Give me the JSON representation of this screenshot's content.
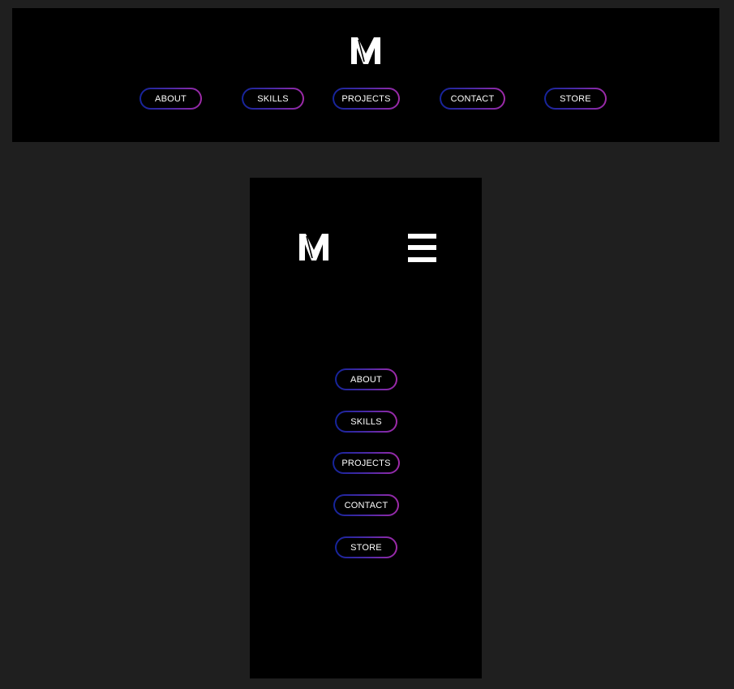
{
  "brand": {
    "logo_letter": "M",
    "logo_color": "#ffffff"
  },
  "theme": {
    "page_background": "#1f1f1f",
    "frame_background": "#000000",
    "pill_gradient_start": "#14249a",
    "pill_gradient_end": "#a02aa8"
  },
  "desktop_nav": {
    "items": [
      {
        "label": "ABOUT"
      },
      {
        "label": "SKILLS"
      },
      {
        "label": "PROJECTS"
      },
      {
        "label": "CONTACT"
      },
      {
        "label": "STORE"
      }
    ]
  },
  "mobile_header": {
    "menu_icon": "hamburger-icon"
  },
  "mobile_nav": {
    "items": [
      {
        "label": "ABOUT"
      },
      {
        "label": "SKILLS"
      },
      {
        "label": "PROJECTS"
      },
      {
        "label": "CONTACT"
      },
      {
        "label": "STORE"
      }
    ]
  }
}
